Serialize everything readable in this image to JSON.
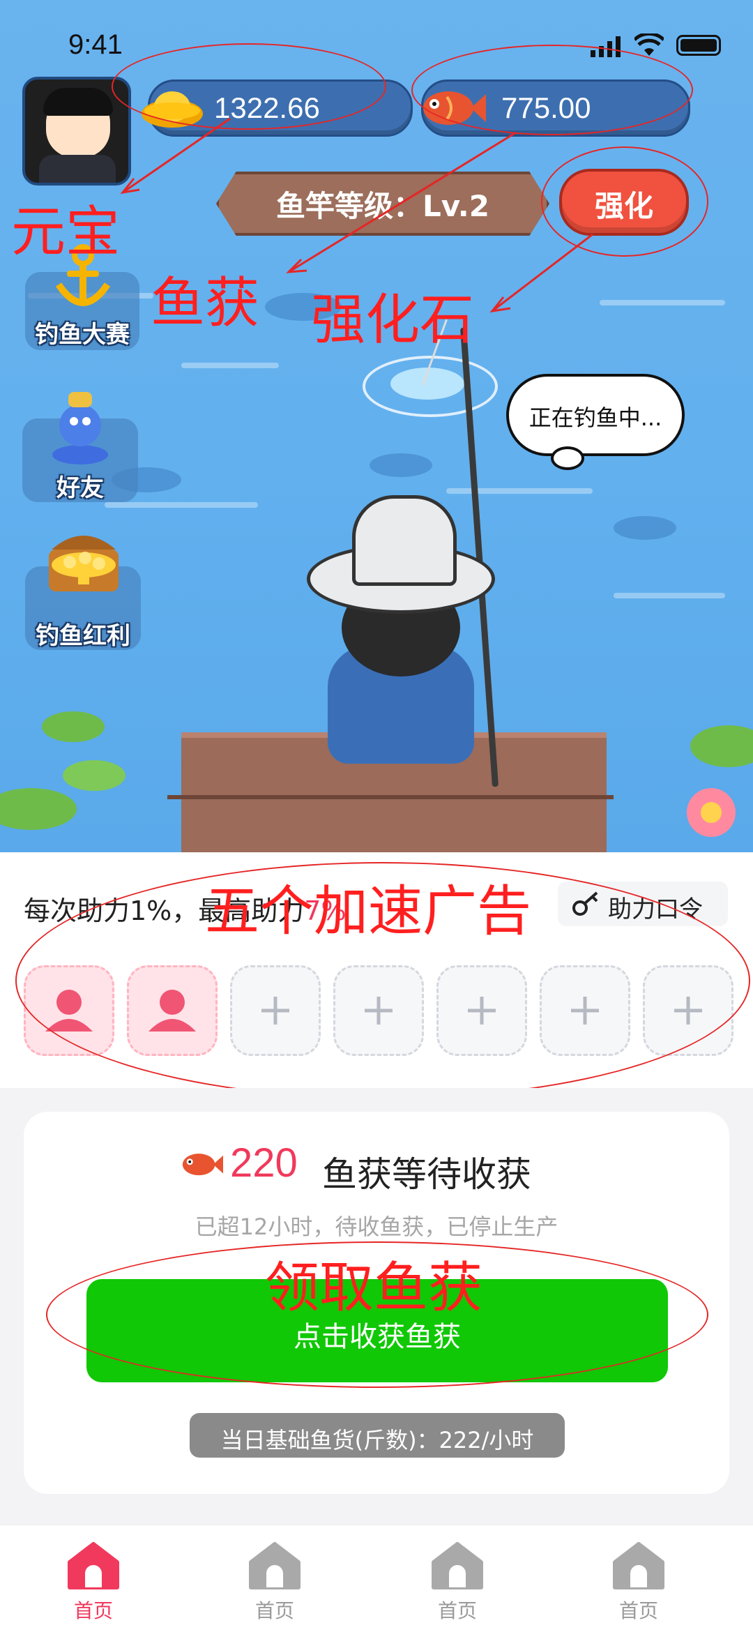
{
  "status_bar": {
    "time": "9:41"
  },
  "currency": {
    "yuanbao": "1322.66",
    "fish": "775.00"
  },
  "rod": {
    "level_label": "鱼竿等级：Lv.2",
    "upgrade_button": "强化"
  },
  "side_buttons": [
    {
      "label": "钓鱼大赛",
      "icon": "anchor-icon"
    },
    {
      "label": "好友",
      "icon": "friend-icon"
    },
    {
      "label": "钓鱼红利",
      "icon": "treasure-chest-icon"
    }
  ],
  "fishing_status": "正在钓鱼中...",
  "annotations": {
    "yuanbao": "元宝",
    "fish_catch": "鱼获",
    "strengthen_stone": "强化石",
    "ads": "五个加速广告",
    "collect": "领取鱼获"
  },
  "assist": {
    "text_prefix": "每次助力1%，最高助力",
    "max_percent": "7%",
    "code_button": "助力口令",
    "slots": [
      "filled",
      "filled",
      "empty",
      "empty",
      "empty",
      "empty",
      "empty"
    ]
  },
  "harvest": {
    "amount": "220",
    "amount_label": "鱼获等待收获",
    "notice": "已超12小时，待收鱼获，已停止生产",
    "button": "点击收获鱼获",
    "base_rate": "当日基础鱼货(斤数)：222/小时"
  },
  "nav": [
    {
      "label": "首页",
      "active": true
    },
    {
      "label": "首页",
      "active": false
    },
    {
      "label": "首页",
      "active": false
    },
    {
      "label": "首页",
      "active": false
    }
  ],
  "colors": {
    "accent_red": "#f0395c",
    "green_button": "#10c805",
    "annotation_red": "#ff1f1f",
    "nav_inactive": "#9a9a9a"
  }
}
